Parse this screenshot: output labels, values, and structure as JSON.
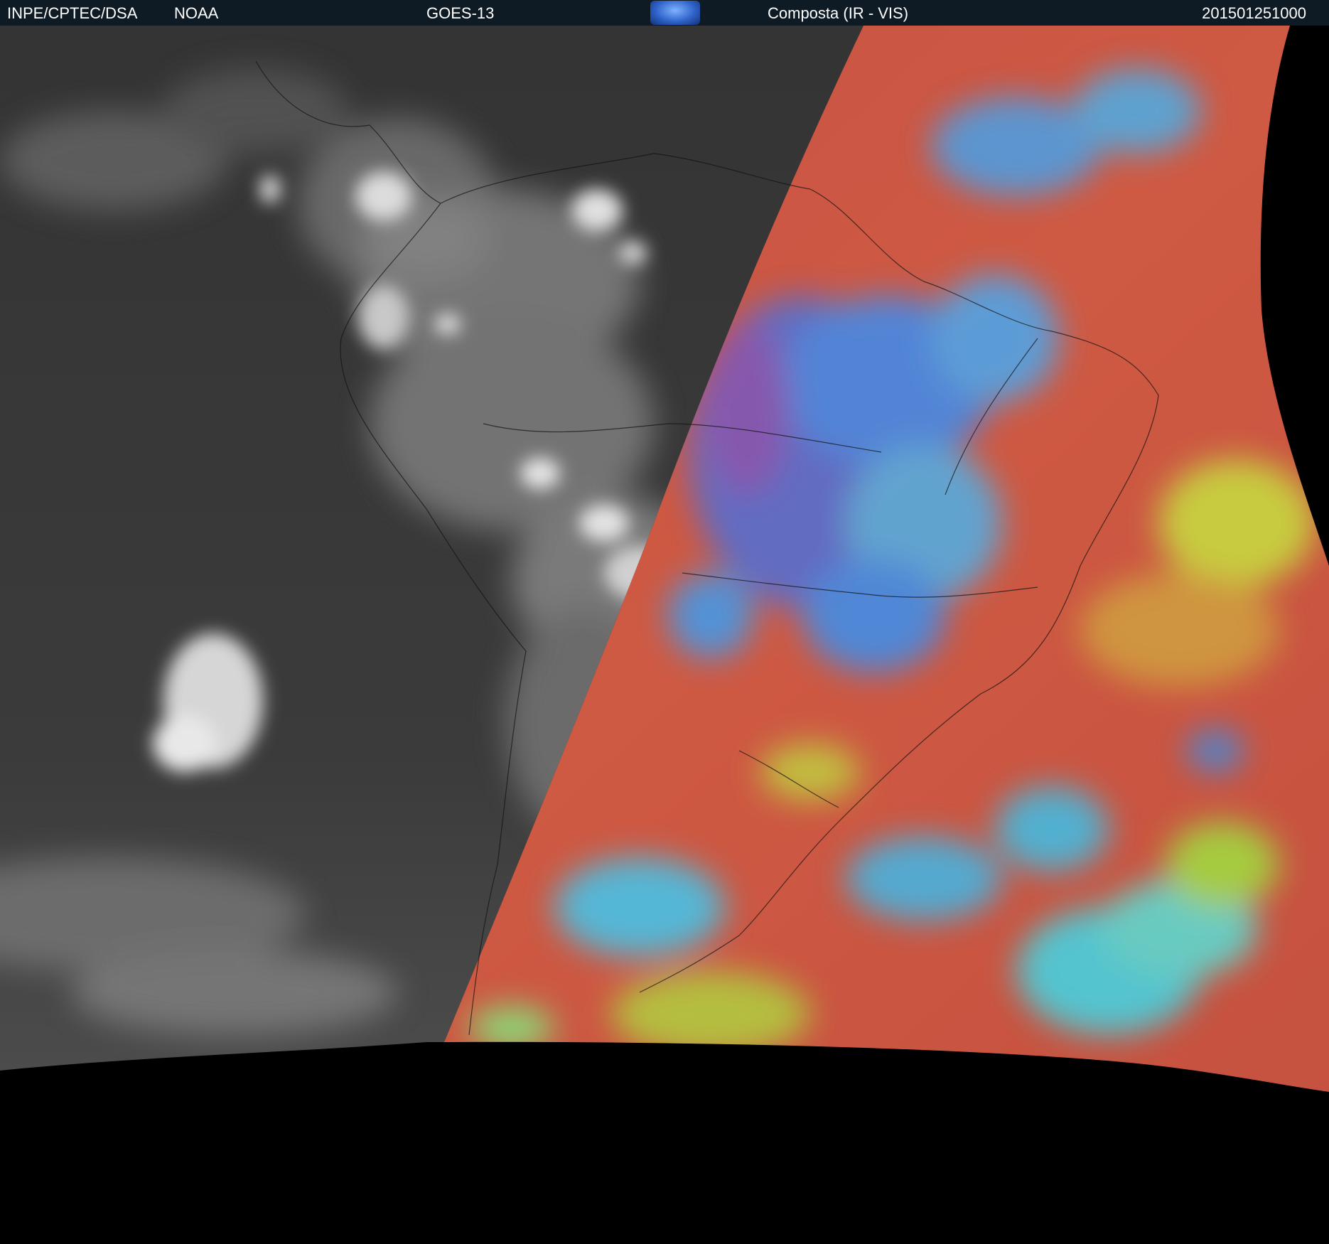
{
  "header": {
    "agency": "INPE/CPTEC/DSA",
    "partner": "NOAA",
    "satellite": "GOES-13",
    "logo_text": "CPTEC",
    "product": "Composta (IR - VIS)",
    "timestamp": "201501251000"
  },
  "colors": {
    "header_bg": "#0e1a24",
    "ir_dark": "#3a3a3a",
    "ir_cloud": "#cfcfcf",
    "vis_red": "#c85048",
    "vis_blue": "#3c8cf0",
    "vis_cyan": "#40d8e8",
    "vis_green": "#b8f040",
    "space": "#000000"
  }
}
